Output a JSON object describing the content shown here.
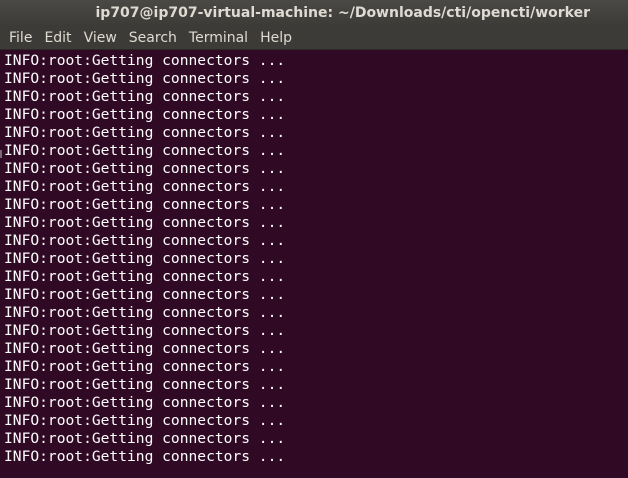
{
  "window": {
    "title": "ip707@ip707-virtual-machine: ~/Downloads/cti/opencti/worker"
  },
  "menu": {
    "items": [
      {
        "label": "File"
      },
      {
        "label": "Edit"
      },
      {
        "label": "View"
      },
      {
        "label": "Search"
      },
      {
        "label": "Terminal"
      },
      {
        "label": "Help"
      }
    ]
  },
  "terminal": {
    "lines": [
      "INFO:root:Getting connectors ...",
      "INFO:root:Getting connectors ...",
      "INFO:root:Getting connectors ...",
      "INFO:root:Getting connectors ...",
      "INFO:root:Getting connectors ...",
      "INFO:root:Getting connectors ...",
      "INFO:root:Getting connectors ...",
      "INFO:root:Getting connectors ...",
      "INFO:root:Getting connectors ...",
      "INFO:root:Getting connectors ...",
      "INFO:root:Getting connectors ...",
      "INFO:root:Getting connectors ...",
      "INFO:root:Getting connectors ...",
      "INFO:root:Getting connectors ...",
      "INFO:root:Getting connectors ...",
      "INFO:root:Getting connectors ...",
      "INFO:root:Getting connectors ...",
      "INFO:root:Getting connectors ...",
      "INFO:root:Getting connectors ...",
      "INFO:root:Getting connectors ...",
      "INFO:root:Getting connectors ...",
      "INFO:root:Getting connectors ...",
      "INFO:root:Getting connectors ..."
    ]
  },
  "colors": {
    "terminal_bg": "#300a24",
    "terminal_fg": "#ffffff",
    "chrome_bg": "#3c3b37",
    "chrome_fg": "#dfdbd2"
  }
}
